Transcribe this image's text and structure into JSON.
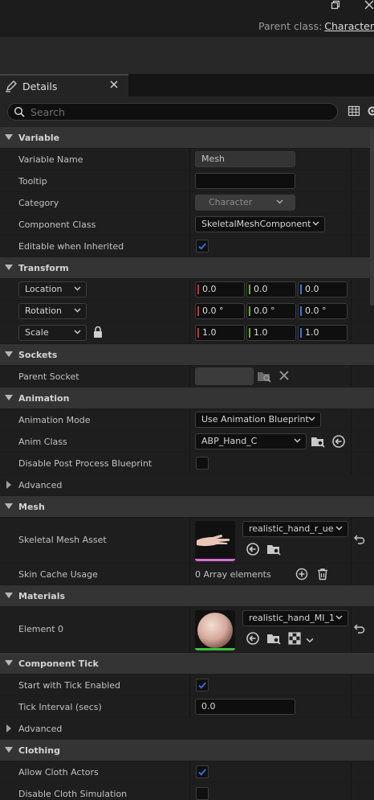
{
  "window": {
    "parent_class_label": "Parent class:",
    "parent_class_value": "Character"
  },
  "tab": {
    "label": "Details"
  },
  "search": {
    "placeholder": "Search"
  },
  "sections": {
    "variable": "Variable",
    "transform": "Transform",
    "sockets": "Sockets",
    "animation": "Animation",
    "mesh": "Mesh",
    "materials": "Materials",
    "component_tick": "Component Tick",
    "clothing": "Clothing"
  },
  "variable": {
    "variable_name_label": "Variable Name",
    "variable_name_value": "Mesh",
    "tooltip_label": "Tooltip",
    "tooltip_value": "",
    "category_label": "Category",
    "category_value": "Character",
    "component_class_label": "Component Class",
    "component_class_value": "SkeletalMeshComponent",
    "editable_label": "Editable when Inherited",
    "editable_checked": true
  },
  "transform": {
    "location_label": "Location",
    "location": [
      "0.0",
      "0.0",
      "0.0"
    ],
    "rotation_label": "Rotation",
    "rotation": [
      "0.0 °",
      "0.0 °",
      "0.0 °"
    ],
    "scale_label": "Scale",
    "scale": [
      "1.0",
      "1.0",
      "1.0"
    ],
    "axis_colors": [
      "#c83232",
      "#6ea82a",
      "#3c78d8"
    ]
  },
  "sockets": {
    "parent_socket_label": "Parent Socket",
    "parent_socket_value": ""
  },
  "animation": {
    "mode_label": "Animation Mode",
    "mode_value": "Use Animation Blueprint",
    "anim_class_label": "Anim Class",
    "anim_class_value": "ABP_Hand_C",
    "disable_pp_label": "Disable Post Process Blueprint",
    "disable_pp_checked": false,
    "advanced_label": "Advanced"
  },
  "mesh": {
    "skeletal_mesh_label": "Skeletal Mesh Asset",
    "skeletal_mesh_value": "realistic_hand_r_ue",
    "skin_cache_label": "Skin Cache Usage",
    "skin_cache_value": "0 Array elements"
  },
  "materials": {
    "element0_label": "Element 0",
    "element0_value": "realistic_hand_MI_1"
  },
  "component_tick": {
    "start_label": "Start with Tick Enabled",
    "start_checked": true,
    "interval_label": "Tick Interval (secs)",
    "interval_value": "0.0",
    "advanced_label": "Advanced"
  },
  "clothing": {
    "allow_label": "Allow Cloth Actors",
    "allow_checked": true,
    "disable_label": "Disable Cloth Simulation",
    "disable_checked": false
  },
  "colors": {
    "accent_check": "#2f6fd8",
    "mesh_thumb_underline": "#d86fd8",
    "material_thumb_underline": "#3cbf3c"
  }
}
